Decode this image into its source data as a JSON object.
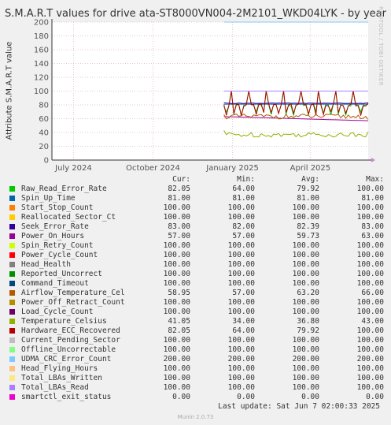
{
  "title": "S.M.A.R.T values for drive ata-ST8000VN004-2M2101_WKD04LYK - by year",
  "side_text": "RRDTOOL / TOBI OETIKER",
  "footer": "Munin 2.0.73",
  "last_update": "Last update: Sat Jun  7 02:00:33 2025",
  "legend_headers": [
    "Cur:",
    "Min:",
    "Avg:",
    "Max:"
  ],
  "chart_data": {
    "type": "line",
    "title": "S.M.A.R.T values for drive ata-ST8000VN004-2M2101_WKD04LYK - by year",
    "ylabel": "Attribute S.M.A.R.T value",
    "ylim": [
      0,
      200
    ],
    "yticks": [
      0,
      20,
      40,
      60,
      80,
      100,
      120,
      140,
      160,
      180,
      200
    ],
    "xlim": [
      "2024-06-06",
      "2025-06-07"
    ],
    "data_start": "2024-12-22",
    "xticks": [
      {
        "label": "July 2024",
        "date": "2024-07-01"
      },
      {
        "label": "October 2024",
        "date": "2024-10-01"
      },
      {
        "label": "January 2025",
        "date": "2025-01-01"
      },
      {
        "label": "April 2025",
        "date": "2025-04-01"
      }
    ],
    "grid": true,
    "series": [
      {
        "name": "Raw_Read_Error_Rate",
        "color": "#00cc00",
        "cur": "82.05",
        "min": "64.00",
        "avg": "79.92",
        "max": "100.00"
      },
      {
        "name": "Spin_Up_Time",
        "color": "#0066b3",
        "cur": "81.00",
        "min": "81.00",
        "avg": "81.00",
        "max": "81.00"
      },
      {
        "name": "Start_Stop_Count",
        "color": "#ff8000",
        "cur": "100.00",
        "min": "100.00",
        "avg": "100.00",
        "max": "100.00"
      },
      {
        "name": "Reallocated_Sector_Ct",
        "color": "#ffcc00",
        "cur": "100.00",
        "min": "100.00",
        "avg": "100.00",
        "max": "100.00"
      },
      {
        "name": "Seek_Error_Rate",
        "color": "#330099",
        "cur": "83.00",
        "min": "82.00",
        "avg": "82.39",
        "max": "83.00"
      },
      {
        "name": "Power_On_Hours",
        "color": "#990099",
        "cur": "57.00",
        "min": "57.00",
        "avg": "59.73",
        "max": "63.00"
      },
      {
        "name": "Spin_Retry_Count",
        "color": "#ccff00",
        "cur": "100.00",
        "min": "100.00",
        "avg": "100.00",
        "max": "100.00"
      },
      {
        "name": "Power_Cycle_Count",
        "color": "#ff0000",
        "cur": "100.00",
        "min": "100.00",
        "avg": "100.00",
        "max": "100.00"
      },
      {
        "name": "Head_Health",
        "color": "#808080",
        "cur": "100.00",
        "min": "100.00",
        "avg": "100.00",
        "max": "100.00"
      },
      {
        "name": "Reported_Uncorrect",
        "color": "#008f00",
        "cur": "100.00",
        "min": "100.00",
        "avg": "100.00",
        "max": "100.00"
      },
      {
        "name": "Command_Timeout",
        "color": "#00487d",
        "cur": "100.00",
        "min": "100.00",
        "avg": "100.00",
        "max": "100.00"
      },
      {
        "name": "Airflow_Temperature_Cel",
        "color": "#b35a00",
        "cur": "58.95",
        "min": "57.00",
        "avg": "63.20",
        "max": "66.00"
      },
      {
        "name": "Power_Off_Retract_Count",
        "color": "#b38f00",
        "cur": "100.00",
        "min": "100.00",
        "avg": "100.00",
        "max": "100.00"
      },
      {
        "name": "Load_Cycle_Count",
        "color": "#6b006b",
        "cur": "100.00",
        "min": "100.00",
        "avg": "100.00",
        "max": "100.00"
      },
      {
        "name": "Temperature_Celsius",
        "color": "#8fb300",
        "cur": "41.05",
        "min": "34.00",
        "avg": "36.80",
        "max": "43.00"
      },
      {
        "name": "Hardware_ECC_Recovered",
        "color": "#b30000",
        "cur": "82.05",
        "min": "64.00",
        "avg": "79.92",
        "max": "100.00"
      },
      {
        "name": "Current_Pending_Sector",
        "color": "#bebebe",
        "cur": "100.00",
        "min": "100.00",
        "avg": "100.00",
        "max": "100.00"
      },
      {
        "name": "Offline_Uncorrectable",
        "color": "#80ff80",
        "cur": "100.00",
        "min": "100.00",
        "avg": "100.00",
        "max": "100.00"
      },
      {
        "name": "UDMA_CRC_Error_Count",
        "color": "#80c9ff",
        "cur": "200.00",
        "min": "200.00",
        "avg": "200.00",
        "max": "200.00"
      },
      {
        "name": "Head_Flying_Hours",
        "color": "#ffc080",
        "cur": "100.00",
        "min": "100.00",
        "avg": "100.00",
        "max": "100.00"
      },
      {
        "name": "Total_LBAs_Written",
        "color": "#ffe680",
        "cur": "100.00",
        "min": "100.00",
        "avg": "100.00",
        "max": "100.00"
      },
      {
        "name": "Total_LBAs_Read",
        "color": "#aa80ff",
        "cur": "100.00",
        "min": "100.00",
        "avg": "100.00",
        "max": "100.00"
      },
      {
        "name": "smartctl_exit_status",
        "color": "#ee00cc",
        "cur": "0.00",
        "min": "0.00",
        "avg": "0.00",
        "max": "0.00"
      }
    ]
  }
}
